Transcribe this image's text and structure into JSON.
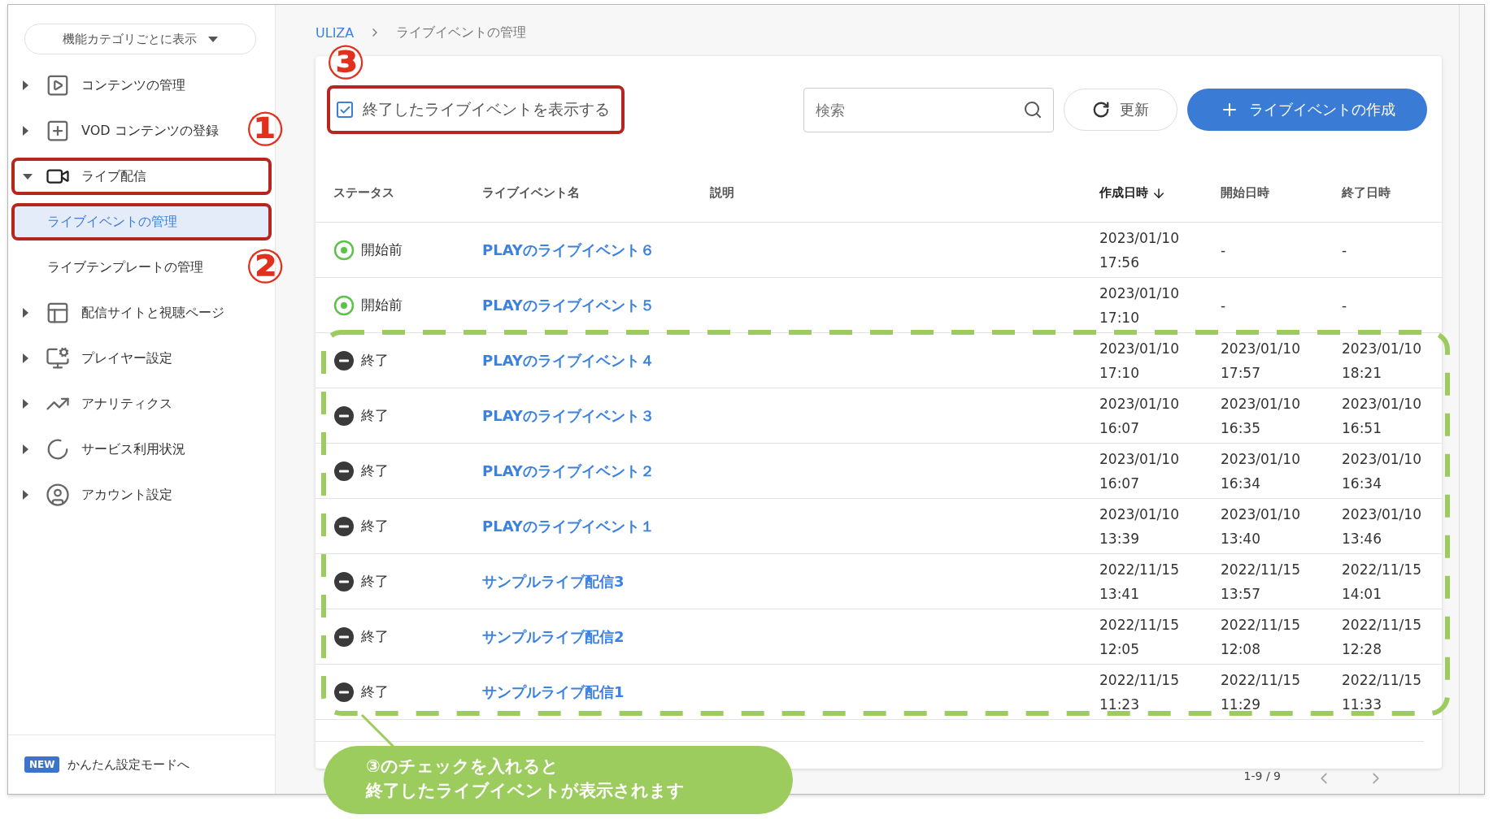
{
  "sidebar": {
    "view_selector": "機能カテゴリごとに表示",
    "items": [
      {
        "label": "コンテンツの管理",
        "expanded": false,
        "selected": false,
        "highlighted": false
      },
      {
        "label": "VOD コンテンツの登録",
        "expanded": false,
        "selected": false,
        "highlighted": false
      },
      {
        "label": "ライブ配信",
        "expanded": true,
        "selected": false,
        "highlighted": true,
        "children": [
          {
            "label": "ライブイベントの管理",
            "selected": true,
            "highlighted": true
          },
          {
            "label": "ライブテンプレートの管理",
            "selected": false,
            "highlighted": false
          }
        ]
      },
      {
        "label": "配信サイトと視聴ページ",
        "expanded": false,
        "selected": false,
        "highlighted": false
      },
      {
        "label": "プレイヤー設定",
        "expanded": false,
        "selected": false,
        "highlighted": false
      },
      {
        "label": "アナリティクス",
        "expanded": false,
        "selected": false,
        "highlighted": false
      },
      {
        "label": "サービス利用状況",
        "expanded": false,
        "selected": false,
        "highlighted": false
      },
      {
        "label": "アカウント設定",
        "expanded": false,
        "selected": false,
        "highlighted": false
      }
    ],
    "footer": {
      "badge": "NEW",
      "label": "かんたん設定モードへ"
    }
  },
  "breadcrumb": [
    "ULIZA",
    "ライブイベントの管理"
  ],
  "toolbar": {
    "show_ended": {
      "label": "終了したライブイベントを表示する",
      "checked": true,
      "highlighted": true
    },
    "search": {
      "placeholder": "検索"
    },
    "refresh": "更新",
    "create": "ライブイベントの作成"
  },
  "table": {
    "columns": [
      {
        "label": "ステータス",
        "sorted": false
      },
      {
        "label": "ライブイベント名",
        "sorted": false
      },
      {
        "label": "説明",
        "sorted": false
      },
      {
        "label": "作成日時",
        "sorted": true
      },
      {
        "label": "開始日時",
        "sorted": false
      },
      {
        "label": "終了日時",
        "sorted": false
      }
    ],
    "rows": [
      {
        "status": {
          "kind": "pending",
          "label": "開始前"
        },
        "name": "PLAYのライブイベント６",
        "created": "2023/01/10 17:56",
        "start": "-",
        "end": "-"
      },
      {
        "status": {
          "kind": "pending",
          "label": "開始前"
        },
        "name": "PLAYのライブイベント５",
        "created": "2023/01/10 17:10",
        "start": "-",
        "end": "-"
      },
      {
        "status": {
          "kind": "ended",
          "label": "終了"
        },
        "name": "PLAYのライブイベント４",
        "created": "2023/01/10 17:10",
        "start": "2023/01/10 17:57",
        "end": "2023/01/10 18:21"
      },
      {
        "status": {
          "kind": "ended",
          "label": "終了"
        },
        "name": "PLAYのライブイベント３",
        "created": "2023/01/10 16:07",
        "start": "2023/01/10 16:35",
        "end": "2023/01/10 16:51"
      },
      {
        "status": {
          "kind": "ended",
          "label": "終了"
        },
        "name": "PLAYのライブイベント２",
        "created": "2023/01/10 16:07",
        "start": "2023/01/10 16:34",
        "end": "2023/01/10 16:34"
      },
      {
        "status": {
          "kind": "ended",
          "label": "終了"
        },
        "name": "PLAYのライブイベント１",
        "created": "2023/01/10 13:39",
        "start": "2023/01/10 13:40",
        "end": "2023/01/10 13:46"
      },
      {
        "status": {
          "kind": "ended",
          "label": "終了"
        },
        "name": "サンプルライブ配信3",
        "created": "2022/11/15 13:41",
        "start": "2022/11/15 13:57",
        "end": "2022/11/15 14:01"
      },
      {
        "status": {
          "kind": "ended",
          "label": "終了"
        },
        "name": "サンプルライブ配信2",
        "created": "2022/11/15 12:05",
        "start": "2022/11/15 12:08",
        "end": "2022/11/15 12:28"
      },
      {
        "status": {
          "kind": "ended",
          "label": "終了"
        },
        "name": "サンプルライブ配信1",
        "created": "2022/11/15 11:23",
        "start": "2022/11/15 11:29",
        "end": "2022/11/15 11:33"
      }
    ]
  },
  "pagination": {
    "range": "1-9 / 9"
  },
  "annotations": [
    {
      "kind": "marker",
      "text": "①"
    },
    {
      "kind": "marker",
      "text": "②"
    },
    {
      "kind": "marker",
      "text": "③"
    },
    {
      "kind": "callout",
      "lines": [
        "③のチェックを入れると",
        "終了したライブイベントが表示されます"
      ]
    }
  ]
}
